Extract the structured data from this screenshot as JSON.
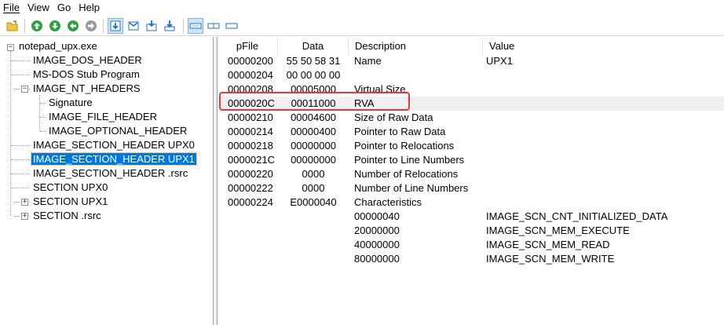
{
  "menu": [
    {
      "label": "File"
    },
    {
      "label": "View"
    },
    {
      "label": "Go"
    },
    {
      "label": "Help"
    }
  ],
  "toolbar": {
    "buttons": [
      {
        "icon": "open-folder-icon"
      },
      {
        "icon": "arrow-up-green-icon"
      },
      {
        "icon": "arrow-down-green-icon"
      },
      {
        "icon": "arrow-left-green-icon"
      },
      {
        "icon": "arrow-right-gray-icon"
      },
      {
        "icon": "view-mode-1-icon"
      },
      {
        "icon": "view-mode-2-icon"
      },
      {
        "icon": "view-mode-3-icon"
      },
      {
        "icon": "view-mode-4-icon"
      },
      {
        "icon": "layout-1-icon"
      },
      {
        "icon": "layout-2-icon"
      },
      {
        "icon": "layout-3-icon"
      }
    ]
  },
  "tree": {
    "root": "notepad_upx.exe",
    "items": [
      {
        "label": "IMAGE_DOS_HEADER"
      },
      {
        "label": "MS-DOS Stub Program"
      },
      {
        "label": "IMAGE_NT_HEADERS"
      },
      {
        "label": "Signature"
      },
      {
        "label": "IMAGE_FILE_HEADER"
      },
      {
        "label": "IMAGE_OPTIONAL_HEADER"
      },
      {
        "label": "IMAGE_SECTION_HEADER UPX0"
      },
      {
        "label": "IMAGE_SECTION_HEADER UPX1"
      },
      {
        "label": "IMAGE_SECTION_HEADER .rsrc"
      },
      {
        "label": "SECTION UPX0"
      },
      {
        "label": "SECTION UPX1"
      },
      {
        "label": "SECTION .rsrc"
      }
    ]
  },
  "columns": {
    "pfile": "pFile",
    "data": "Data",
    "description": "Description",
    "value": "Value"
  },
  "rows": [
    {
      "pfile": "00000200",
      "data": "55  50  58  31",
      "description": "Name",
      "value": "UPX1"
    },
    {
      "pfile": "00000204",
      "data": "00  00  00  00",
      "description": "",
      "value": ""
    },
    {
      "pfile": "00000208",
      "data": "00005000",
      "description": "Virtual Size",
      "value": ""
    },
    {
      "pfile": "0000020C",
      "data": "00011000",
      "description": "RVA",
      "value": ""
    },
    {
      "pfile": "00000210",
      "data": "00004600",
      "description": "Size of Raw Data",
      "value": ""
    },
    {
      "pfile": "00000214",
      "data": "00000400",
      "description": "Pointer to Raw Data",
      "value": ""
    },
    {
      "pfile": "00000218",
      "data": "00000000",
      "description": "Pointer to Relocations",
      "value": ""
    },
    {
      "pfile": "0000021C",
      "data": "00000000",
      "description": "Pointer to Line Numbers",
      "value": ""
    },
    {
      "pfile": "00000220",
      "data": "0000",
      "description": "Number of Relocations",
      "value": ""
    },
    {
      "pfile": "00000222",
      "data": "0000",
      "description": "Number of Line Numbers",
      "value": ""
    },
    {
      "pfile": "00000224",
      "data": "E0000040",
      "description": "Characteristics",
      "value": ""
    },
    {
      "pfile": "",
      "data": "",
      "description": "00000040",
      "value": "IMAGE_SCN_CNT_INITIALIZED_DATA"
    },
    {
      "pfile": "",
      "data": "",
      "description": "20000000",
      "value": "IMAGE_SCN_MEM_EXECUTE"
    },
    {
      "pfile": "",
      "data": "",
      "description": "40000000",
      "value": "IMAGE_SCN_MEM_READ"
    },
    {
      "pfile": "",
      "data": "",
      "description": "80000000",
      "value": "IMAGE_SCN_MEM_WRITE"
    }
  ],
  "colors": {
    "selection": "#0078d7",
    "annotation": "#e53935",
    "toolbar_green": "#2e9e3e",
    "toolbar_blue": "#1c6fc9"
  }
}
